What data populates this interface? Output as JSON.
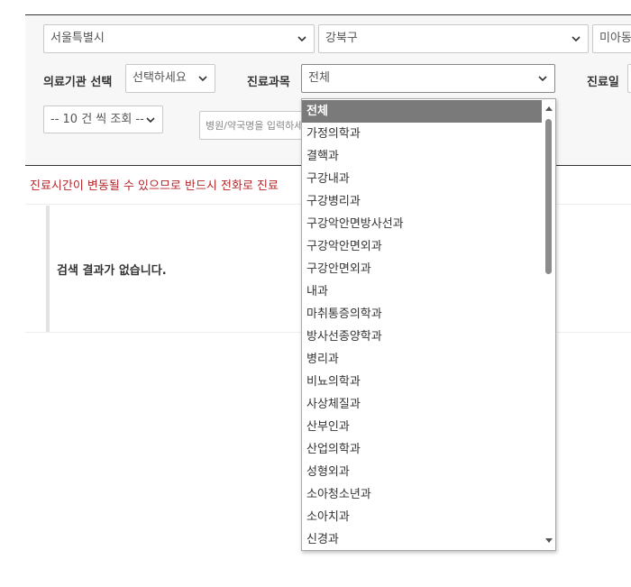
{
  "filters": {
    "city": "서울특별시",
    "district": "강북구",
    "dong": "미아동",
    "institution_label": "의료기관 선택",
    "institution_value": "선택하세요",
    "department_label": "진료과목",
    "department_value": "전체",
    "date_label": "진료일",
    "page_size_value": "-- 10 건 씩 조회 --",
    "search_placeholder": "병원/약국명을 입력하세요"
  },
  "notice": "진료시간이 변동될 수 있으므로 반드시 전화로 진료",
  "results": {
    "empty_message": "검색 결과가 없습니다."
  },
  "department_dropdown": {
    "selected": "전체",
    "options": [
      "전체",
      "가정의학과",
      "결핵과",
      "구강내과",
      "구강병리과",
      "구강악안면방사선과",
      "구강악안면외과",
      "구강안면외과",
      "내과",
      "마취통증의학과",
      "방사선종양학과",
      "병리과",
      "비뇨의학과",
      "사상체질과",
      "산부인과",
      "산업의학과",
      "성형외과",
      "소아청소년과",
      "소아치과",
      "신경과"
    ]
  },
  "icons": {
    "chevron": "chevron-down-icon",
    "scroll_up": "scroll-up-arrow-icon",
    "scroll_down": "scroll-down-arrow-icon"
  },
  "colors": {
    "notice": "#b4262b",
    "selected_option_bg": "#7a7a7a",
    "panel_bg": "#f7f7f7"
  }
}
